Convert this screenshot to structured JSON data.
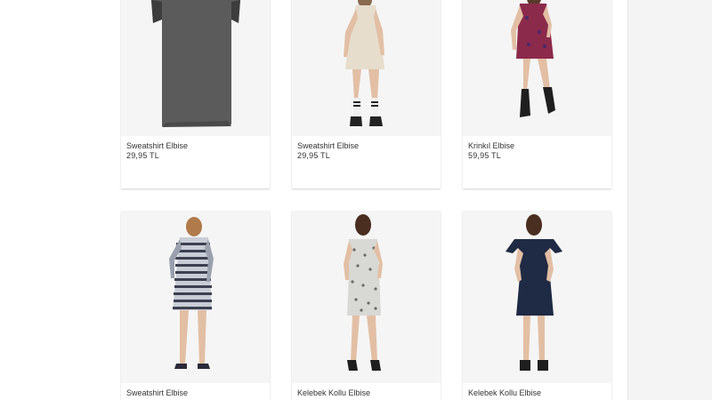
{
  "products": [
    {
      "name": "Sweatshirt Elbise",
      "price": "29,95 TL"
    },
    {
      "name": "Sweatshirt Elbise",
      "price": "29,95 TL"
    },
    {
      "name": "Krinkıl Elbise",
      "price": "59,95 TL"
    },
    {
      "name": "Sweatshirt Elbise",
      "price": ""
    },
    {
      "name": "Kelebek Kollu Elbise",
      "price": ""
    },
    {
      "name": "Kelebek Kollu Elbise",
      "price": ""
    }
  ],
  "colors": {
    "page_bg": "#ffffff",
    "photo_bg": "#f5f5f5",
    "side_panel": "#f4f4f4",
    "text": "#333333"
  }
}
